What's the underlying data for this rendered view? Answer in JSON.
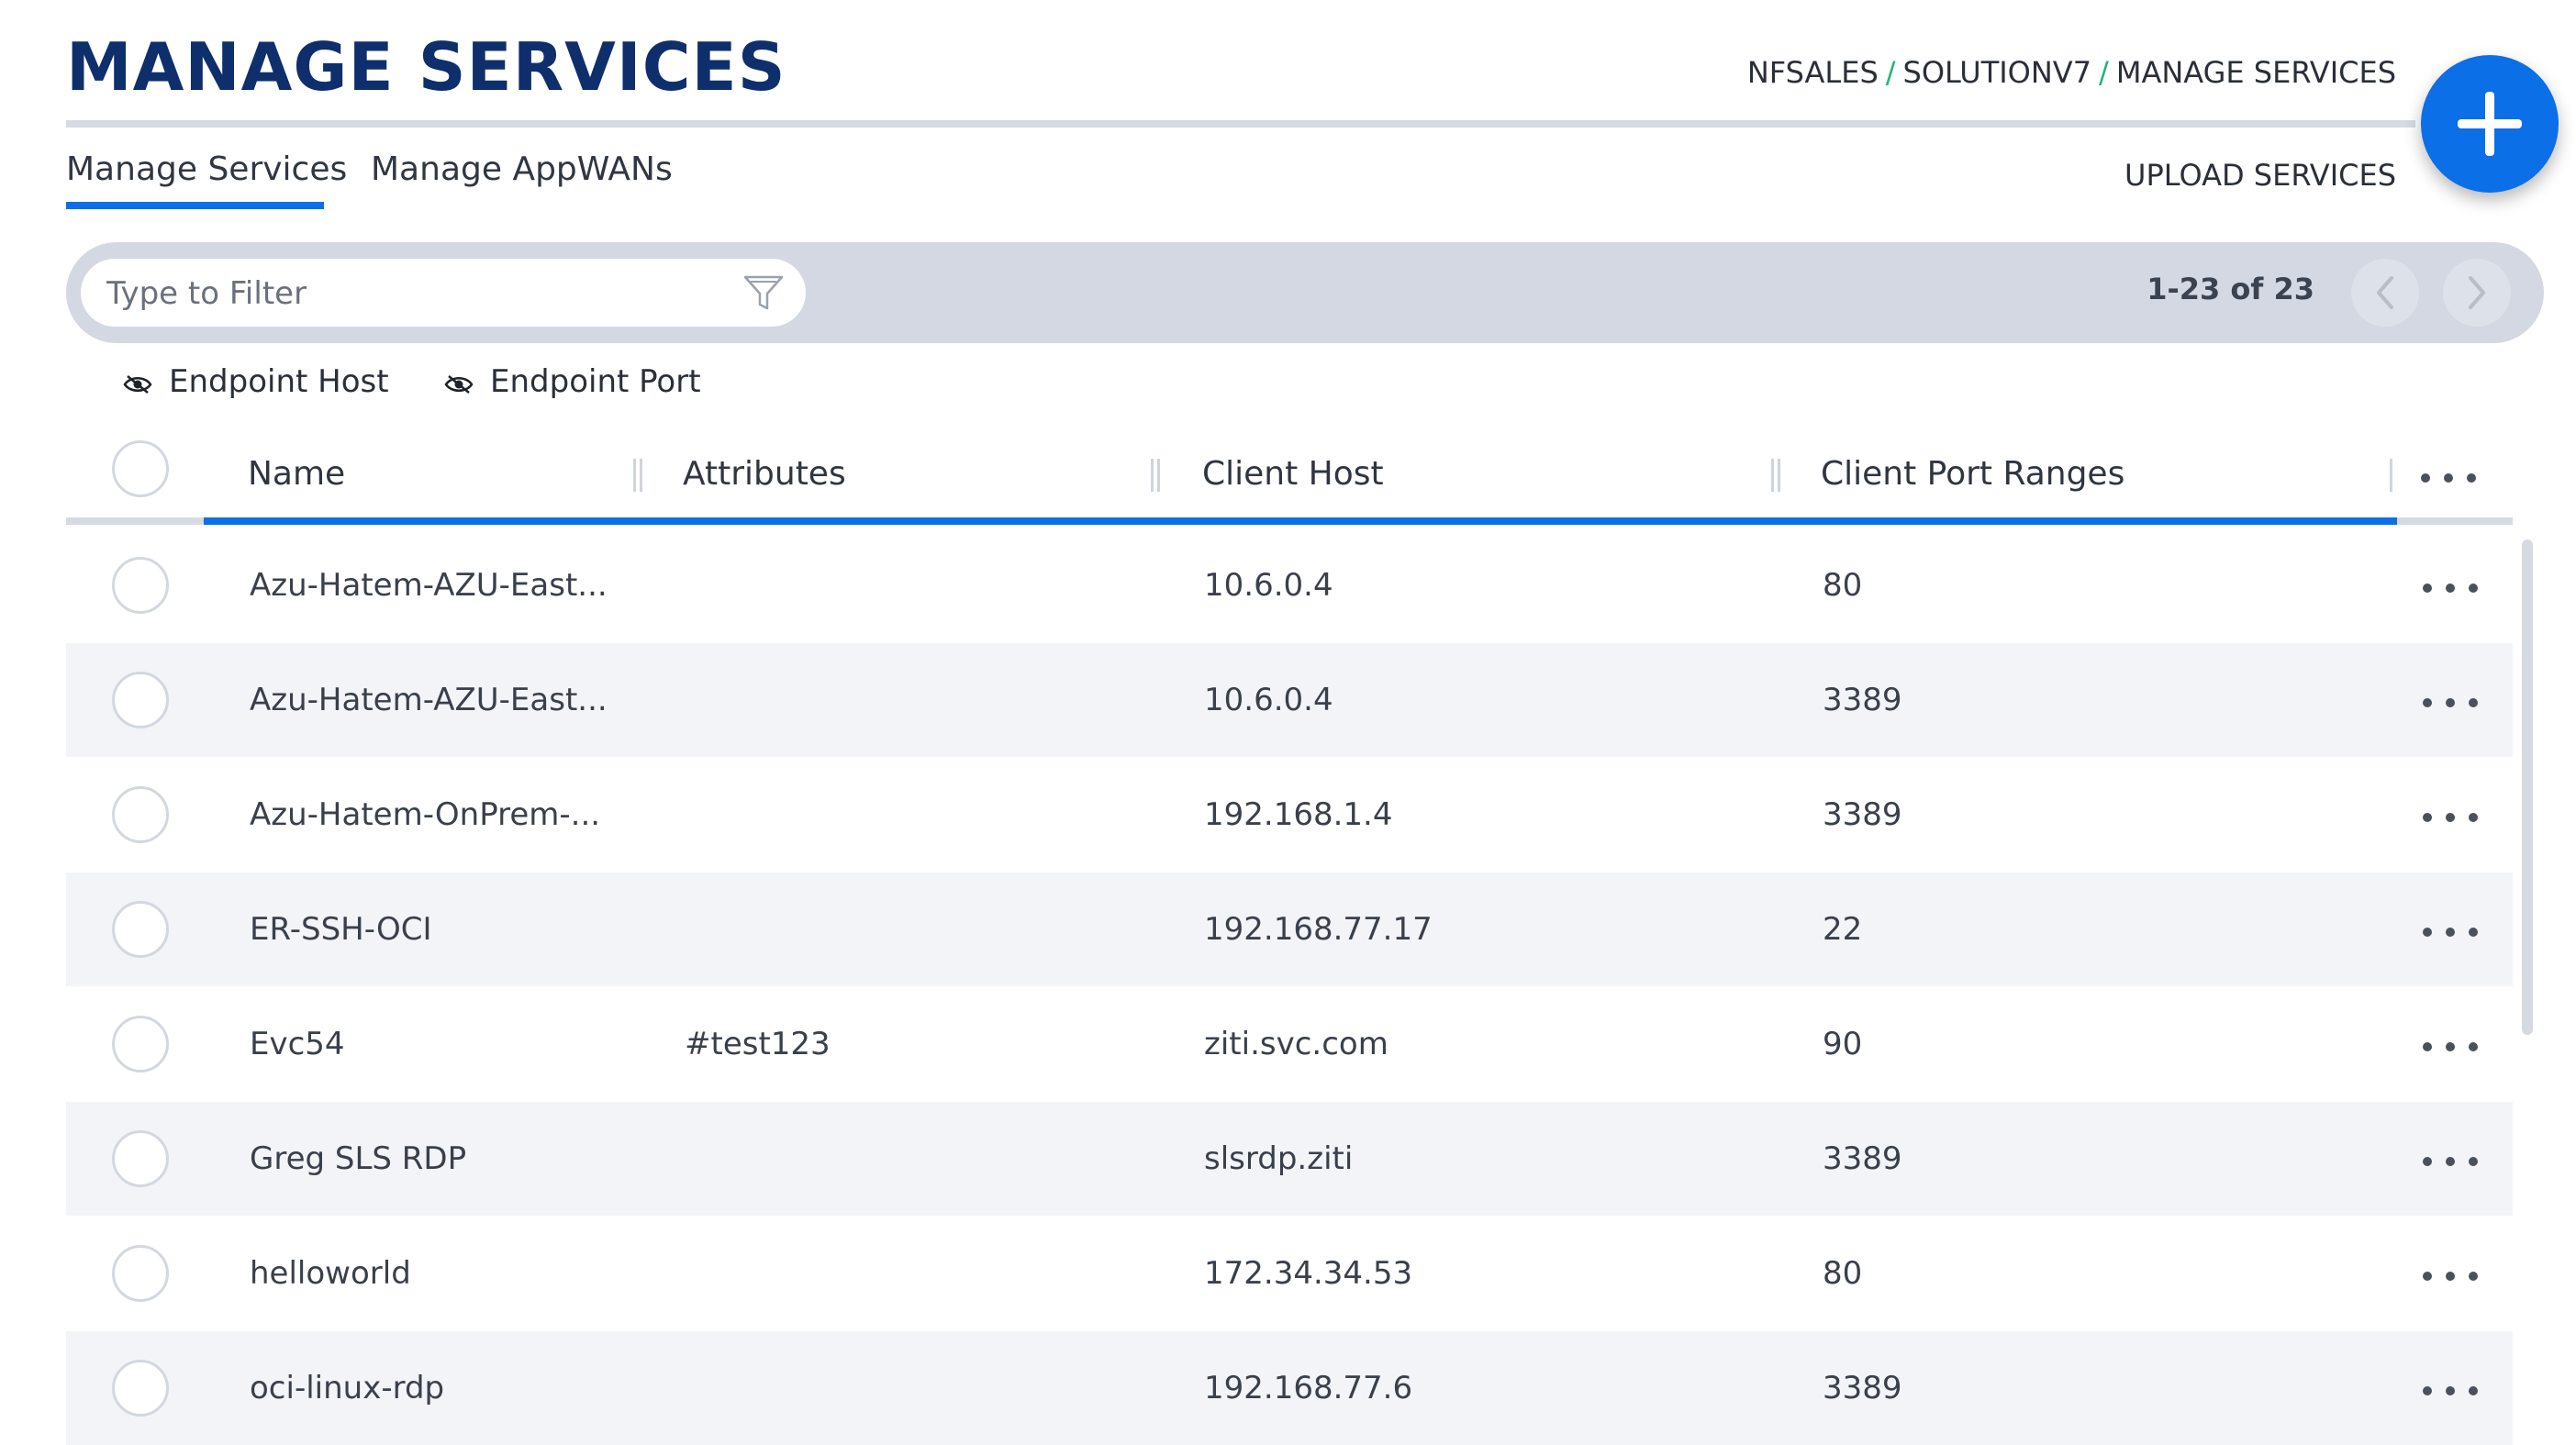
{
  "header": {
    "title": "MANAGE SERVICES",
    "breadcrumb": [
      "NFSALES",
      "SOLUTIONV7",
      "MANAGE SERVICES"
    ],
    "breadcrumb_separator": "/"
  },
  "tabs": [
    {
      "label": "Manage Services",
      "active": true
    },
    {
      "label": "Manage AppWANs",
      "active": false
    }
  ],
  "actions": {
    "upload_label": "UPLOAD SERVICES",
    "add_icon": "plus-icon"
  },
  "filter": {
    "placeholder": "Type to Filter",
    "value": ""
  },
  "pagination": {
    "text": "1-23 of 23"
  },
  "column_toggles": [
    {
      "label": "Endpoint Host",
      "icon": "eye-off-icon"
    },
    {
      "label": "Endpoint Port",
      "icon": "eye-off-icon"
    }
  ],
  "table": {
    "columns": [
      "Name",
      "Attributes",
      "Client Host",
      "Client Port Ranges"
    ],
    "rows": [
      {
        "name": "Azu-Hatem-AZU-East...",
        "attributes": "",
        "client_host": "10.6.0.4",
        "client_ports": "80"
      },
      {
        "name": "Azu-Hatem-AZU-East...",
        "attributes": "",
        "client_host": "10.6.0.4",
        "client_ports": "3389"
      },
      {
        "name": "Azu-Hatem-OnPrem-...",
        "attributes": "",
        "client_host": "192.168.1.4",
        "client_ports": "3389"
      },
      {
        "name": "ER-SSH-OCI",
        "attributes": "",
        "client_host": "192.168.77.17",
        "client_ports": "22"
      },
      {
        "name": "Evc54",
        "attributes": "#test123",
        "client_host": "ziti.svc.com",
        "client_ports": "90"
      },
      {
        "name": "Greg SLS RDP",
        "attributes": "",
        "client_host": "slsrdp.ziti",
        "client_ports": "3389"
      },
      {
        "name": "helloworld",
        "attributes": "",
        "client_host": "172.34.34.53",
        "client_ports": "80"
      },
      {
        "name": "oci-linux-rdp",
        "attributes": "",
        "client_host": "192.168.77.6",
        "client_ports": "3389"
      }
    ]
  },
  "colors": {
    "title": "#0f2f6c",
    "accent": "#0b6fe8",
    "breadcrumb_separator": "#22b573",
    "filter_bar": "#d4d8e2",
    "row_alt": "#f2f4f7"
  }
}
